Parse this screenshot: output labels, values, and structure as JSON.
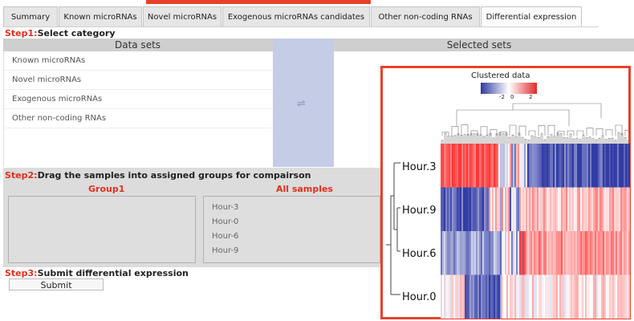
{
  "tabs": [
    {
      "label": "Summary",
      "active": false
    },
    {
      "label": "Known microRNAs",
      "active": false
    },
    {
      "label": "Novel microRNAs",
      "active": false
    },
    {
      "label": "Exogenous microRNAs candidates",
      "active": false
    },
    {
      "label": "Other non-coding RNAs",
      "active": false
    },
    {
      "label": "Differential expression",
      "active": true
    }
  ],
  "step1": {
    "prefix": "Step1:",
    "text": "Select category"
  },
  "datasets": {
    "header_left": "Data sets",
    "header_right": "Selected sets",
    "items": [
      "Known microRNAs",
      "Novel microRNAs",
      "Exogenous microRNAs",
      "Other non-coding RNAs"
    ]
  },
  "step2": {
    "prefix": "Step2:",
    "text": "Drag the samples into assigned groups for compairson"
  },
  "group1_label": "Group1",
  "all_samples_label": "All samples",
  "samples": [
    "Hour-3",
    "Hour-0",
    "Hour-6",
    "Hour-9"
  ],
  "step3": {
    "prefix": "Step3:",
    "text": "Submit differential expression"
  },
  "submit_label": "Submit",
  "cluster": {
    "title": "Clustered data",
    "key_min": "-2",
    "key_mid": "0",
    "key_max": "2",
    "rows": [
      "Hour.3",
      "Hour.9",
      "Hour.6",
      "Hour.0"
    ]
  },
  "colors": {
    "accent_red": "#e8412b",
    "heat_blue": "#3c46a8",
    "heat_red": "#e03a3a",
    "mid_panel": "#c5cce6"
  }
}
